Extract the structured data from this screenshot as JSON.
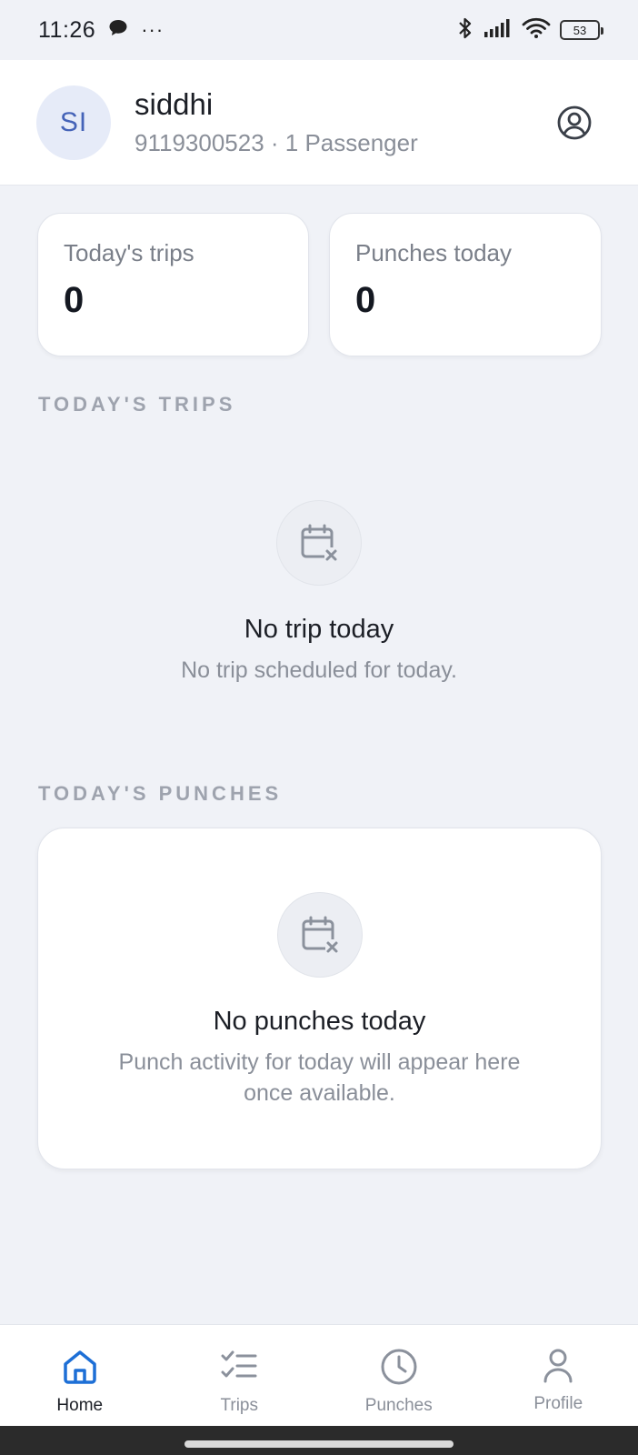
{
  "status_bar": {
    "time": "11:26",
    "dots": "···",
    "battery": "53"
  },
  "header": {
    "avatar_initials": "SI",
    "name": "siddhi",
    "subtitle": "9119300523 · 1 Passenger"
  },
  "stats": {
    "trips_label": "Today's trips",
    "trips_value": "0",
    "punches_label": "Punches today",
    "punches_value": "0"
  },
  "trips_section": {
    "title": "TODAY'S TRIPS",
    "empty_title": "No trip today",
    "empty_subtitle": "No trip scheduled for today."
  },
  "punches_section": {
    "title": "TODAY'S PUNCHES",
    "empty_title": "No punches today",
    "empty_subtitle_line1": "Punch activity for today will appear here",
    "empty_subtitle_line2": "once available."
  },
  "nav": {
    "items": [
      {
        "label": "Home",
        "icon": "home-icon",
        "active": true
      },
      {
        "label": "Trips",
        "icon": "checklist-icon",
        "active": false
      },
      {
        "label": "Punches",
        "icon": "clock-icon",
        "active": false
      },
      {
        "label": "Profile",
        "icon": "person-icon",
        "active": false
      }
    ]
  },
  "colors": {
    "accent": "#1d6fd6",
    "background": "#f0f2f7",
    "avatar_bg": "#e6ebf8",
    "avatar_text": "#4563b8"
  }
}
